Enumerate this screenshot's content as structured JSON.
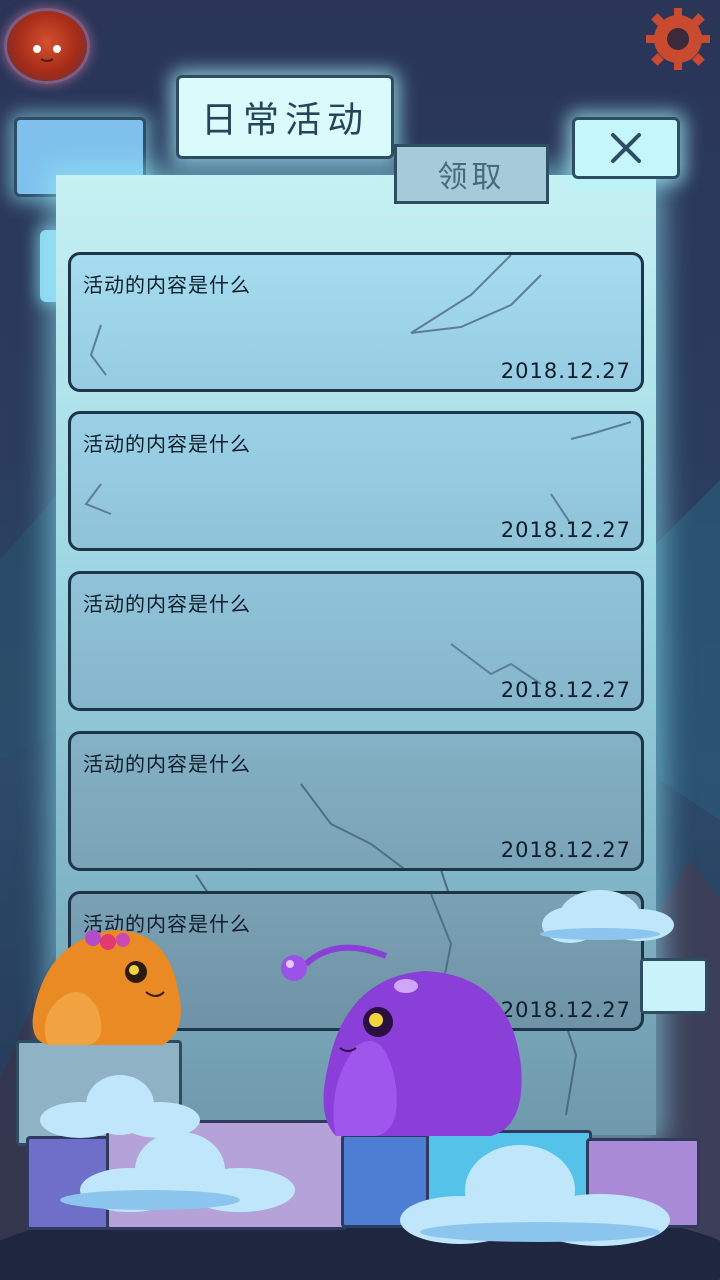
{
  "header": {
    "title": "日常活动",
    "claim_tab": "领取"
  },
  "activities": [
    {
      "title": "活动的内容是什么",
      "date": "2018.12.27"
    },
    {
      "title": "活动的内容是什么",
      "date": "2018.12.27"
    },
    {
      "title": "活动的内容是什么",
      "date": "2018.12.27"
    },
    {
      "title": "活动的内容是什么",
      "date": "2018.12.27"
    },
    {
      "title": "活动的内容是什么",
      "date": "2018.12.27"
    }
  ],
  "icons": {
    "close": "close-icon",
    "settings": "gear-icon",
    "avatar": "slime-avatar"
  },
  "colors": {
    "panel_top": "#c6f1f3",
    "panel_bottom": "#6f98ab",
    "card_border": "#1e3447",
    "tab_active": "#d9fbfb",
    "tab_inactive": "#a5cad8",
    "gear": "#c94a2e",
    "purple_slime": "#8a3fd8",
    "orange_slime": "#e98a24"
  }
}
